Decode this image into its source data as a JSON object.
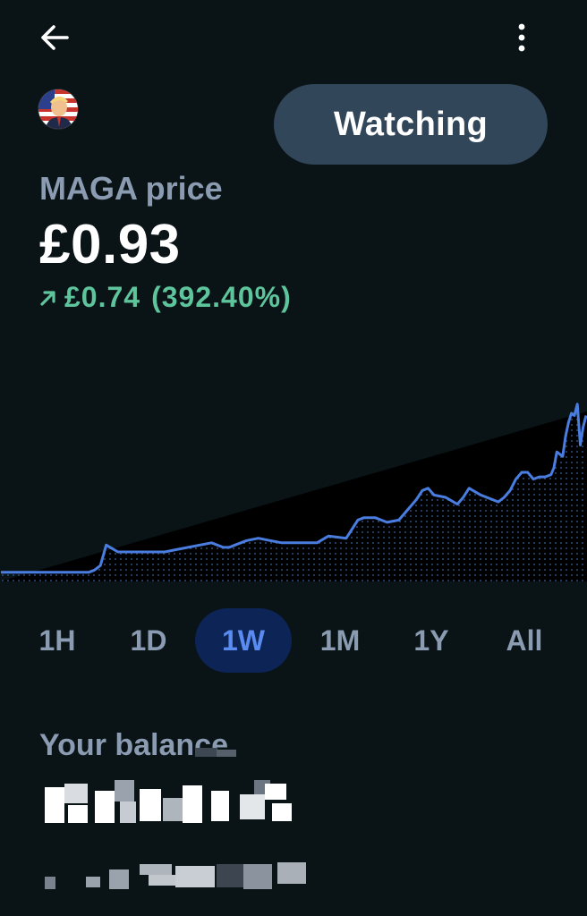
{
  "header": {
    "back_icon": "arrow-left-icon",
    "more_icon": "vertical-ellipsis-icon"
  },
  "token": {
    "avatar_icon": "token-avatar-icon",
    "name_label": "MAGA price",
    "price": "£0.93",
    "change_direction_icon": "arrow-up-right-icon",
    "change_value": "£0.74",
    "change_percent": "(392.40%)",
    "change_color": "#5ec49c"
  },
  "watch_button": {
    "label": "Watching",
    "background": "#32465a"
  },
  "chart_data": {
    "type": "area",
    "series": [
      {
        "x": [
          0,
          3,
          6,
          9,
          12,
          15,
          16,
          17,
          18,
          20,
          24,
          28,
          30,
          36,
          38,
          39,
          40,
          42,
          44,
          46,
          48,
          50,
          54,
          56,
          59,
          60,
          61,
          62,
          64,
          65,
          66,
          68,
          70,
          71,
          72,
          73,
          74,
          76,
          78,
          79,
          80,
          82,
          84,
          85,
          86,
          87,
          88,
          89,
          90,
          91,
          92,
          93,
          94,
          94.5,
          95,
          96,
          96.5,
          97,
          97.5,
          98,
          98.5,
          99,
          99.5,
          100
        ],
        "values": [
          0.19,
          0.19,
          0.19,
          0.19,
          0.19,
          0.19,
          0.2,
          0.22,
          0.31,
          0.28,
          0.28,
          0.28,
          0.29,
          0.32,
          0.3,
          0.3,
          0.31,
          0.33,
          0.34,
          0.33,
          0.32,
          0.32,
          0.32,
          0.35,
          0.34,
          0.38,
          0.42,
          0.43,
          0.43,
          0.42,
          0.41,
          0.42,
          0.48,
          0.51,
          0.55,
          0.56,
          0.53,
          0.52,
          0.49,
          0.52,
          0.56,
          0.53,
          0.51,
          0.5,
          0.52,
          0.55,
          0.6,
          0.63,
          0.63,
          0.6,
          0.61,
          0.61,
          0.62,
          0.65,
          0.72,
          0.7,
          0.79,
          0.85,
          0.89,
          0.88,
          0.93,
          0.75,
          0.83,
          0.88
        ],
        "color": "#4a7de0"
      }
    ],
    "ylim": [
      0.15,
      1.0
    ],
    "grid": false,
    "fill": "dotted-area"
  },
  "timeframes": {
    "items": [
      "1H",
      "1D",
      "1W",
      "1M",
      "1Y",
      "All"
    ],
    "selected": "1W",
    "active_background": "#0c2456",
    "active_color": "#5a8bf0"
  },
  "balance": {
    "label": "Your balance"
  }
}
